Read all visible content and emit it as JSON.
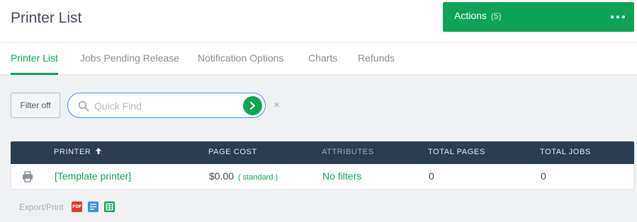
{
  "header": {
    "title": "Printer List",
    "actions": {
      "label": "Actions",
      "count": "(5)",
      "more_icon": "more-horizontal-icon"
    }
  },
  "tabs": [
    {
      "label": "Printer List",
      "active": true
    },
    {
      "label": "Jobs Pending Release",
      "active": false
    },
    {
      "label": "Notification Options",
      "active": false
    },
    {
      "label": "Charts",
      "active": false
    },
    {
      "label": "Refunds",
      "active": false
    }
  ],
  "toolbar": {
    "filter_label": "Filter off",
    "search_placeholder": "Quick Find",
    "search_value": "",
    "clear_symbol": "×"
  },
  "table": {
    "columns": {
      "printer": "PRINTER",
      "page_cost": "PAGE COST",
      "attributes": "ATTRIBUTES",
      "total_pages": "TOTAL PAGES",
      "total_jobs": "TOTAL JOBS"
    },
    "sort": {
      "column": "printer",
      "direction": "ascending"
    },
    "rows": [
      {
        "icon": "printer-icon",
        "printer": "[Template printer]",
        "page_cost": "$0.00",
        "cost_type": "( standard )",
        "attributes": "No filters",
        "total_pages": "0",
        "total_jobs": "0"
      }
    ]
  },
  "export": {
    "label": "Export/Print",
    "pdf_text": "PDF",
    "icons": [
      "pdf-icon",
      "print-list-icon",
      "spreadsheet-icon"
    ]
  },
  "colors": {
    "accent": "#0fa356",
    "table_header": "#2c3d51",
    "focus": "#3d8fd6"
  }
}
